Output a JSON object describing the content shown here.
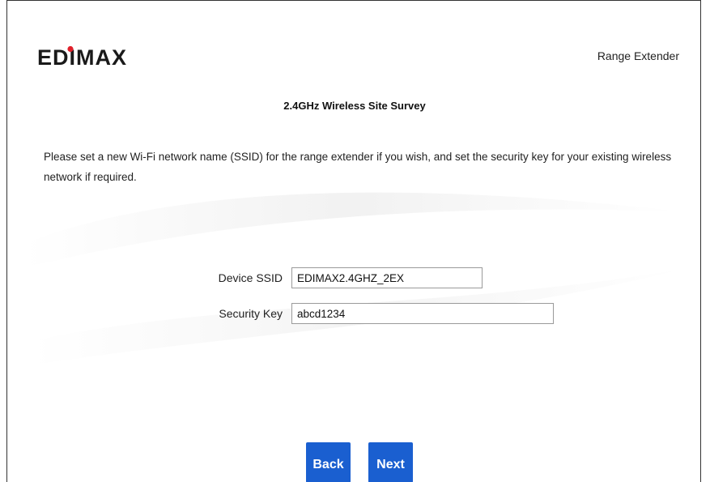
{
  "header": {
    "logo_text": "EDIMAX",
    "product_label": "Range Extender"
  },
  "page": {
    "heading": "2.4GHz Wireless Site Survey",
    "instruction": "Please set a new Wi-Fi network name (SSID) for the range extender if you wish, and set the security key for your existing wireless network if required."
  },
  "form": {
    "ssid_label": "Device SSID",
    "ssid_value": "EDIMAX2.4GHZ_2EX",
    "key_label": "Security Key",
    "key_value": "abcd1234"
  },
  "buttons": {
    "back_label": "Back",
    "next_label": "Next"
  },
  "colors": {
    "accent": "#1a5fd0",
    "logo": "#1a1a1a",
    "logo_dot": "#e0202a"
  }
}
